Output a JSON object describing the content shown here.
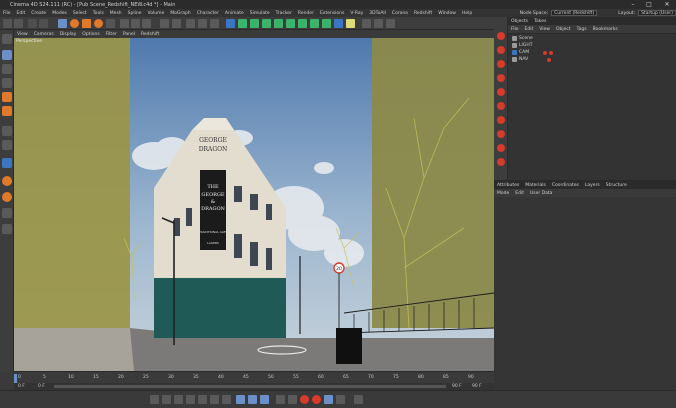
{
  "window": {
    "title": "Cinema 4D S24.111 (RC) - [Pub Scene_Redshift_NEW.c4d *] - Main",
    "minimize": "–",
    "maximize": "□",
    "close": "✕"
  },
  "menubar": {
    "items": [
      "File",
      "Edit",
      "Create",
      "Modes",
      "Select",
      "Tools",
      "Mesh",
      "Spline",
      "Volume",
      "MoGraph",
      "Character",
      "Animate",
      "Simulate",
      "Tracker",
      "Render",
      "Extensions",
      "V-Ray",
      "3DToAll",
      "Corona",
      "Redshift",
      "Window",
      "Help"
    ],
    "node_space_label": "Node Space:",
    "node_space_value": "Current (Redshift)",
    "layout_label": "Layout:",
    "layout_value": "Startup (User)"
  },
  "viewport": {
    "menu": [
      "View",
      "Cameras",
      "Display",
      "Options",
      "Filter",
      "Panel",
      "Redshift"
    ],
    "label": "Perspective",
    "sign_top": "GEORGE",
    "sign_top2": "DRAGON",
    "sign_main1": "THE",
    "sign_main2": "GEORGE",
    "sign_main3": "&",
    "sign_main4": "DRAGON",
    "sign_traditional": "TRADITIONAL ALES",
    "sign_lagers": "LAGERS",
    "speed_sign": "20"
  },
  "timeline": {
    "ticks": [
      "0",
      "5",
      "10",
      "15",
      "20",
      "25",
      "30",
      "35",
      "40",
      "45",
      "50",
      "55",
      "60",
      "65",
      "70",
      "75",
      "80",
      "85",
      "90"
    ],
    "current_frame": "0 F",
    "start_frame": "0 F",
    "end_frame": "90 F",
    "end_frame2": "90 F"
  },
  "objects_panel": {
    "tabs": [
      "Objects",
      "Takes"
    ],
    "menu": [
      "File",
      "Edit",
      "View",
      "Object",
      "Tags",
      "Bookmarks"
    ],
    "rows": [
      {
        "name": "Scene"
      },
      {
        "name": "LIGHT"
      },
      {
        "name": "CAM"
      },
      {
        "name": "NAV"
      }
    ]
  },
  "attributes_panel": {
    "tabs": [
      "Attributes",
      "Materials",
      "Coordinates",
      "Layers",
      "Structure"
    ],
    "menu": [
      "Mode",
      "Edit",
      "User Data"
    ]
  },
  "colors": {
    "accent_orange": "#e07a2a",
    "green": "#3bb36a",
    "red": "#d63b2b",
    "blue": "#3a76c4",
    "tree_yellow": "#c9c15a"
  }
}
